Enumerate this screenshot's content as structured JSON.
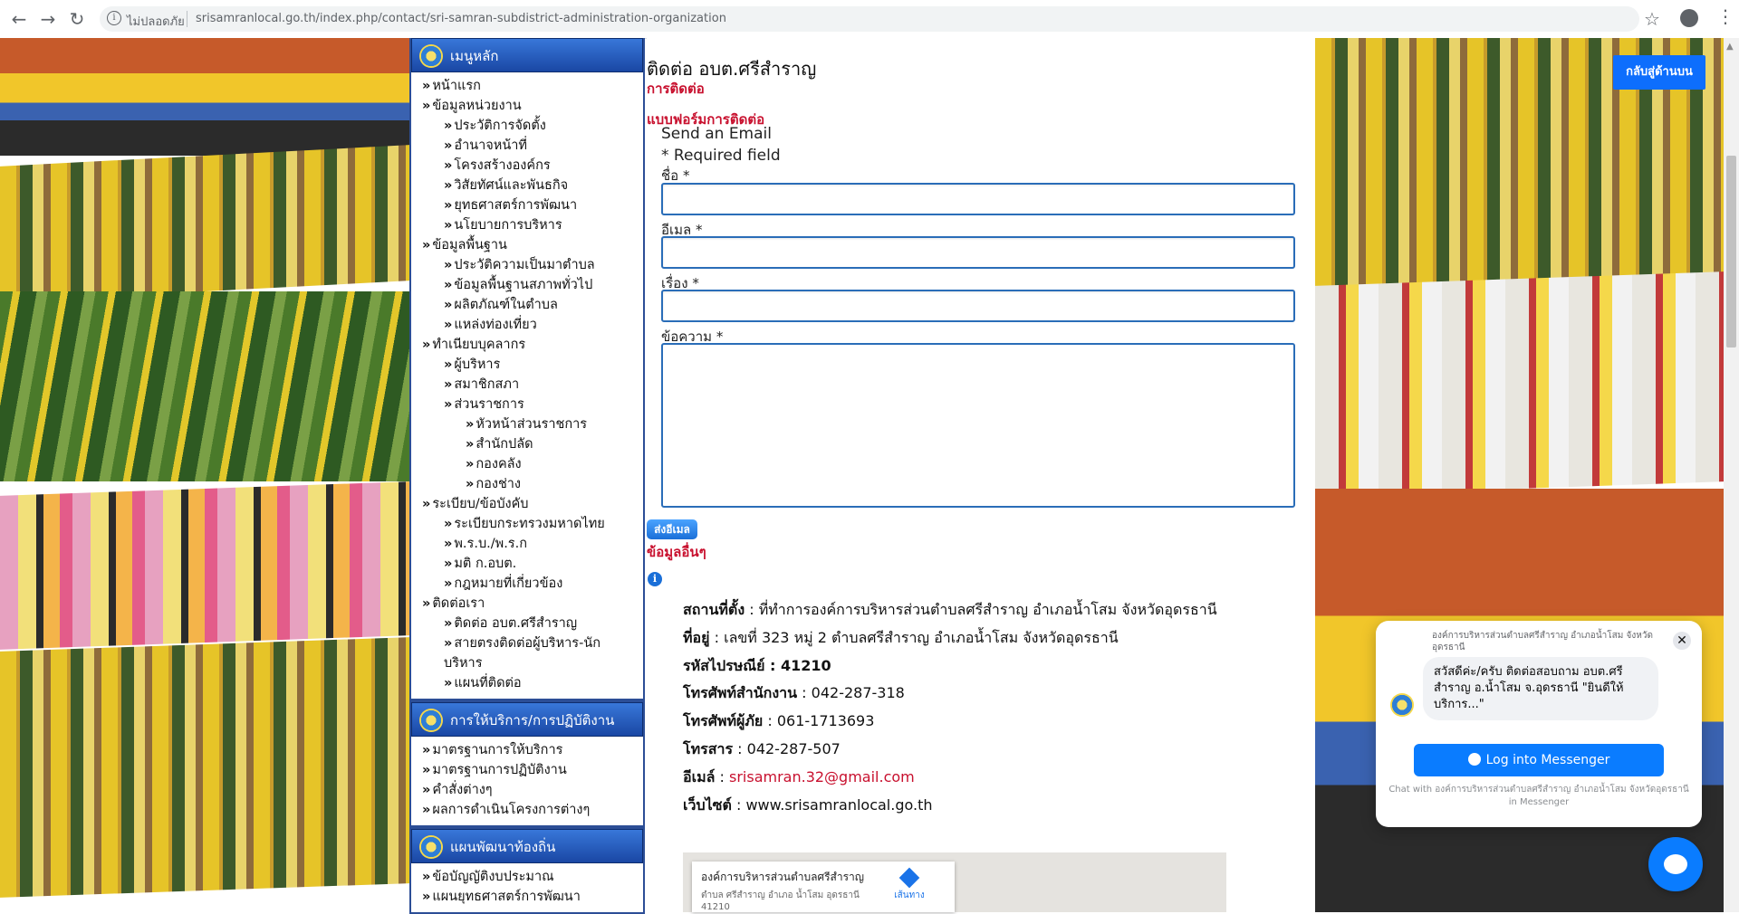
{
  "browser": {
    "back_icon": "back-arrow-icon",
    "forward_icon": "forward-arrow-icon",
    "reload_icon": "reload-icon",
    "security_text": "ไม่ปลอดภัย",
    "url": "srisamranlocal.go.th/index.php/contact/sri-samran-subdistrict-administration-organization"
  },
  "sidebar": {
    "sections": [
      {
        "title": "เมนูหลัก",
        "items": [
          {
            "label": "หน้าแรก",
            "level": 1
          },
          {
            "label": "ข้อมูลหน่วยงาน",
            "level": 1
          },
          {
            "label": "ประวัติการจัดตั้ง",
            "level": 2
          },
          {
            "label": "อำนาจหน้าที่",
            "level": 2
          },
          {
            "label": "โครงสร้างองค์กร",
            "level": 2
          },
          {
            "label": "วิสัยทัศน์และพันธกิจ",
            "level": 2
          },
          {
            "label": "ยุทธศาสตร์การพัฒนา",
            "level": 2
          },
          {
            "label": "นโยบายการบริหาร",
            "level": 2
          },
          {
            "label": "ข้อมูลพื้นฐาน",
            "level": 1
          },
          {
            "label": "ประวัติความเป็นมาตำบล",
            "level": 2
          },
          {
            "label": "ข้อมูลพื้นฐานสภาพทั่วไป",
            "level": 2
          },
          {
            "label": "ผลิตภัณฑ์ในตำบล",
            "level": 2
          },
          {
            "label": "แหล่งท่องเที่ยว",
            "level": 2
          },
          {
            "label": "ทำเนียบบุคลากร",
            "level": 1
          },
          {
            "label": "ผู้บริหาร",
            "level": 2
          },
          {
            "label": "สมาชิกสภา",
            "level": 2
          },
          {
            "label": "ส่วนราชการ",
            "level": 2
          },
          {
            "label": "หัวหน้าส่วนราชการ",
            "level": 3
          },
          {
            "label": "สำนักปลัด",
            "level": 3
          },
          {
            "label": "กองคลัง",
            "level": 3
          },
          {
            "label": "กองช่าง",
            "level": 3
          },
          {
            "label": "ระเบียบ/ข้อบังคับ",
            "level": 1
          },
          {
            "label": "ระเบียบกระทรวงมหาดไทย",
            "level": 2
          },
          {
            "label": "พ.ร.บ./พ.ร.ก",
            "level": 2
          },
          {
            "label": "มติ ก.อบต.",
            "level": 2
          },
          {
            "label": "กฎหมายที่เกี่ยวข้อง",
            "level": 2
          },
          {
            "label": "ติดต่อเรา",
            "level": 1
          },
          {
            "label": "ติดต่อ อบต.ศรีสำราญ",
            "level": 2
          },
          {
            "label": "สายตรงติดต่อผู้บริหาร-นักบริหาร",
            "level": 2
          },
          {
            "label": "แผนที่ติดต่อ",
            "level": 2
          }
        ]
      },
      {
        "title": "การให้บริการ/การปฏิบัติงาน",
        "items": [
          {
            "label": "มาตรฐานการให้บริการ",
            "level": 1
          },
          {
            "label": "มาตรฐานการปฏิบัติงาน",
            "level": 1
          },
          {
            "label": "คำสั่งต่างๆ",
            "level": 1
          },
          {
            "label": "ผลการดำเนินโครงการต่างๆ",
            "level": 1
          }
        ]
      },
      {
        "title": "แผนพัฒนาท้องถิ่น",
        "items": [
          {
            "label": "ข้อบัญญัติงบประมาณ",
            "level": 1
          },
          {
            "label": "แผนยุทธศาสตร์การพัฒนา",
            "level": 1
          }
        ]
      }
    ]
  },
  "main": {
    "title": "ติดต่อ อบต.ศรีสำราญ",
    "contact_heading": "การติดต่อ",
    "form_heading": "แบบฟอร์มการติดต่อ",
    "send_email": "Send an Email",
    "required_note": "* Required field",
    "fields": {
      "name_label": "ชื่อ",
      "email_label": "อีเมล",
      "subject_label": "เรื่อง",
      "message_label": "ข้อความ",
      "required_marker": "*"
    },
    "submit_label": "ส่งอีเมล",
    "other_info_heading": "ข้อมูลอื่นๆ",
    "contact": {
      "location_label": "สถานที่ตั้ง",
      "location_value": "ที่ทำการองค์การบริหารส่วนตำบลศรีสำราญ อำเภอน้ำโสม จังหวัดอุดรธานี",
      "address_label": "ที่อยู่",
      "address_value": "เลขที่ 323 หมู่ 2 ตำบลศรีสำราญ อำเภอน้ำโสม จังหวัดอุดรธานี",
      "postal_label": "รหัสไปรษณีย์",
      "postal_value": "41210",
      "office_phone_label": "โทรศัพท์สำนักงาน",
      "office_phone_value": "042-287-318",
      "mobile_label": "โทรศัพท์ผู้ภัย",
      "mobile_value": "061-1713693",
      "fax_label": "โทรสาร",
      "fax_value": "042-287-507",
      "email_label": "อีเมล์",
      "email_value": "srisamran.32@gmail.com",
      "website_label": "เว็บไซต์",
      "website_value": "www.srisamranlocal.go.th"
    },
    "map": {
      "place_name": "องค์การบริหารส่วนตำบลศรีสำราญ",
      "place_address": "ตำบล ศรีสำราญ อำเภอ น้ำโสม อุดรธานี 41210",
      "directions_label": "เส้นทาง"
    }
  },
  "back_to_top_label": "กลับสู่ด้านบน",
  "messenger": {
    "org_name": "องค์การบริหารส่วนตำบลศรีสำราญ อำเภอน้ำโสม จังหวัดอุดรธานี",
    "greeting": "สวัสดีค่ะ/ครับ ติดต่อสอบถาม อบต.ศรีสำราญ อ.น้ำโสม จ.อุดรธานี \"ยินดีให้บริการ...\"",
    "login_label": "Log into Messenger",
    "footer": "Chat with องค์การบริหารส่วนตำบลศรีสำราญ อำเภอน้ำโสม จังหวัดอุดรธานี in Messenger",
    "accent": "#0a7cff"
  },
  "colors": {
    "menu_header_top": "#3877d9",
    "menu_header_bottom": "#1a47a4",
    "heading_red": "#c8102e",
    "input_border": "#2a6db8"
  }
}
